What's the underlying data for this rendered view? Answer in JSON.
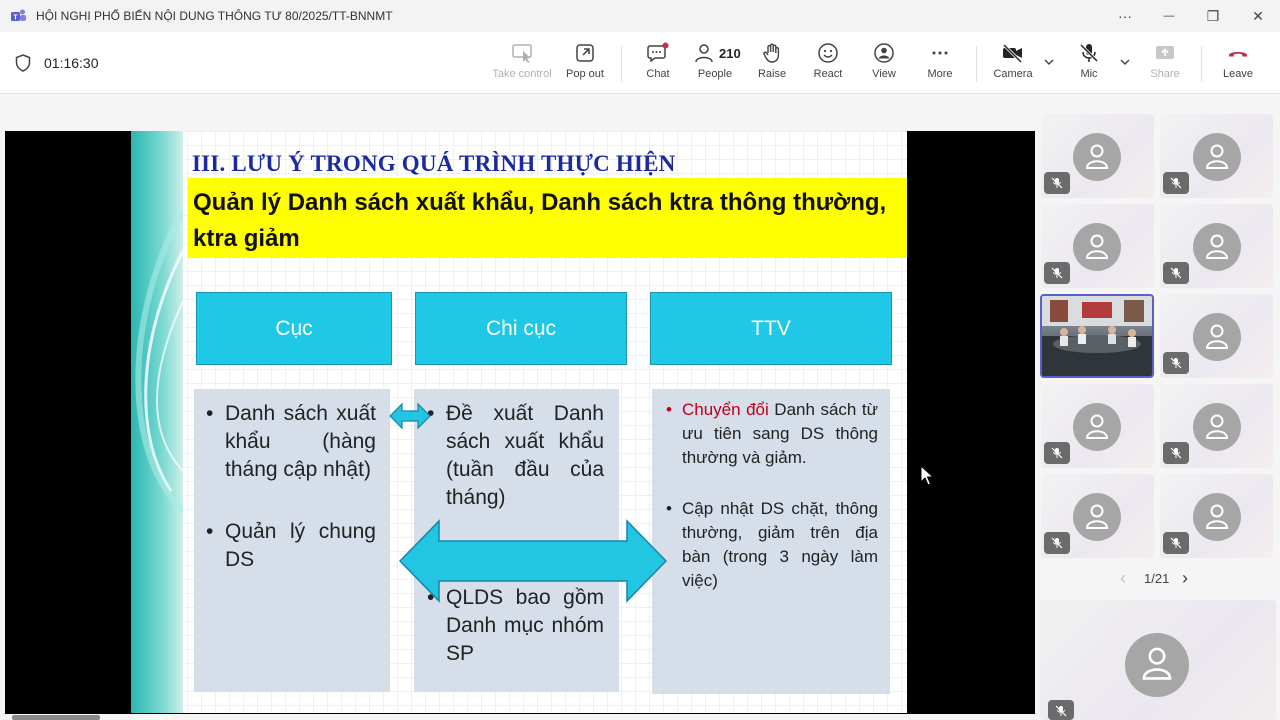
{
  "window": {
    "title": "HỘI NGHỊ PHỔ BIẾN NỘI DUNG THÔNG TƯ 80/2025/TT-BNNMT",
    "more_glyph": "···",
    "minimize_glyph": "—",
    "restore_glyph": "❐",
    "close_glyph": "✕"
  },
  "meeting": {
    "timer": "01:16:30"
  },
  "toolbar": {
    "take_control": "Take control",
    "pop_out": "Pop out",
    "chat": "Chat",
    "people": "People",
    "people_count": "210",
    "raise": "Raise",
    "react": "React",
    "view": "View",
    "more": "More",
    "camera": "Camera",
    "mic": "Mic",
    "share": "Share",
    "leave": "Leave"
  },
  "slide": {
    "heading": "III. LƯU Ý TRONG QUÁ TRÌNH THỰC HIỆN",
    "subtitle": "Quản lý Danh sách xuất khẩu, Danh sách ktra thông thường, ktra giảm",
    "columns": [
      {
        "header": "Cục"
      },
      {
        "header": "Chi cục"
      },
      {
        "header": "TTV"
      }
    ],
    "cuc_bullets": [
      "Danh sách xuất khẩu (hàng tháng cập nhật)",
      "Quản lý chung DS"
    ],
    "chicuc_bullets": [
      "Đề xuất Danh sách xuất khẩu (tuần đầu của tháng)",
      "QLDS bao gồm Danh mục nhóm SP"
    ],
    "ttv_bullet1_red": "Chuyển đổi",
    "ttv_bullet1_rest": " Danh sách từ ưu tiên sang DS thông thường và giảm.",
    "ttv_bullet2": "Cập nhật DS chặt, thông thường, giảm trên địa bàn (trong 3 ngày làm việc)",
    "bullet_glyph": "•"
  },
  "gallery": {
    "page_indicator": "1/21",
    "prev_glyph": "‹",
    "next_glyph": "›"
  },
  "colors": {
    "heading_blue": "#1b2a9e",
    "yellow": "#ffff00",
    "cyan_box": "#1ec8e6",
    "arrow_cyan": "#22c6e2",
    "leave_red": "#c4314b",
    "teams_purple": "#5b5fc7"
  }
}
